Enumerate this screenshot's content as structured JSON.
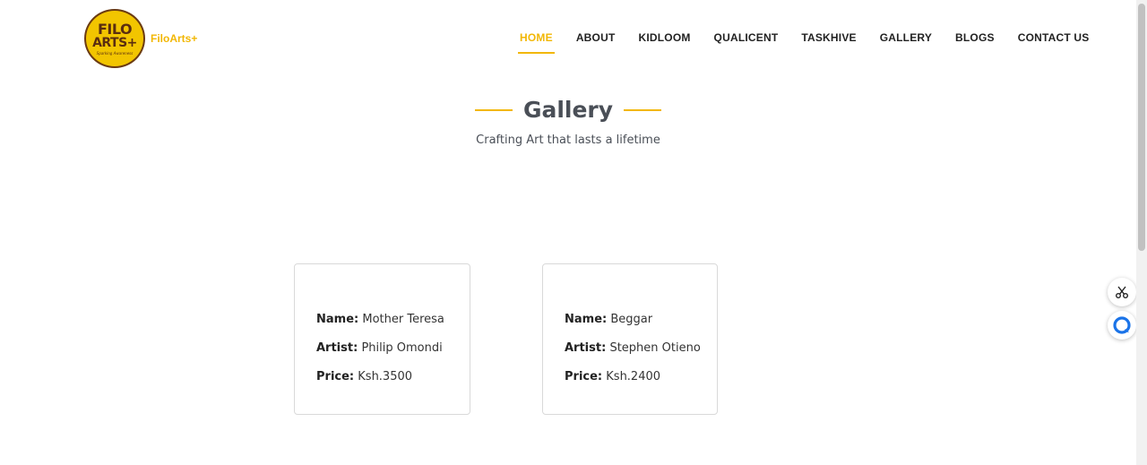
{
  "brand": {
    "logo_line1": "FILO",
    "logo_line2": "ARTS+",
    "logo_tagline": "Sparking Awareness",
    "name": "FiloArts+"
  },
  "nav": {
    "items": [
      {
        "label": "HOME",
        "active": true
      },
      {
        "label": "ABOUT",
        "active": false
      },
      {
        "label": "KIDLOOM",
        "active": false
      },
      {
        "label": "QUALICENT",
        "active": false
      },
      {
        "label": "TASKHIVE",
        "active": false
      },
      {
        "label": "GALLERY",
        "active": false
      },
      {
        "label": "BLOGS",
        "active": false
      },
      {
        "label": "CONTACT US",
        "active": false
      }
    ]
  },
  "section": {
    "title": "Gallery",
    "subtitle": "Crafting Art that lasts a lifetime"
  },
  "labels": {
    "name": "Name:",
    "artist": "Artist:",
    "price": "Price:"
  },
  "cards": [
    {
      "name": "Mother Teresa",
      "artist": "Philip Omondi",
      "price": "Ksh.3500"
    },
    {
      "name": "Beggar",
      "artist": "Stephen Otieno",
      "price": "Ksh.2400"
    }
  ],
  "floating": {
    "icon1": "scissors-icon",
    "icon2": "chat-bubble-icon"
  },
  "colors": {
    "accent": "#f2b705",
    "heading": "#4a4f57"
  }
}
